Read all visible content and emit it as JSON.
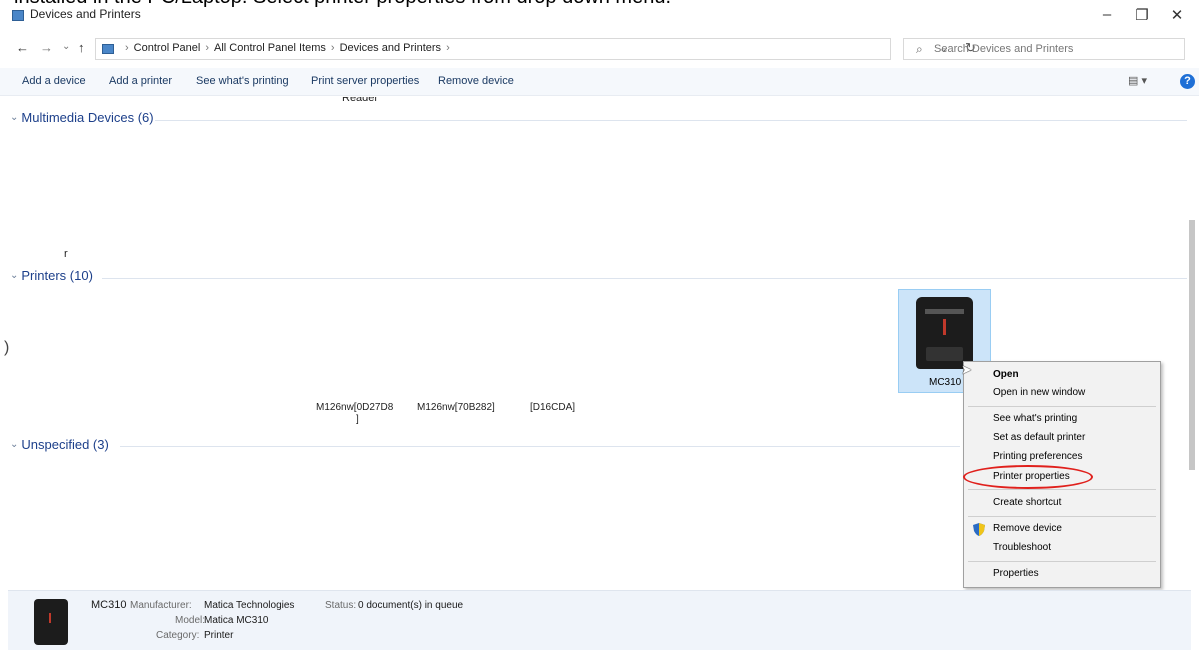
{
  "caption": "installed in the PC/Laptop. Select printer properties from drop down menu.",
  "window": {
    "title": "Devices and Printers",
    "controls": {
      "minimize": "–",
      "maximize": "❐",
      "close": "✕"
    }
  },
  "nav": {
    "back": "←",
    "forward": "→",
    "recent": "⌄",
    "up": "↑",
    "breadcrumb": [
      "Control Panel",
      "All Control Panel Items",
      "Devices and Printers"
    ],
    "breadcrumb_sep": "›",
    "dropdown": "⌄",
    "refresh": "↻",
    "search_placeholder": "Search Devices and Printers",
    "search_icon": "⌕"
  },
  "toolbar": {
    "add_device": "Add a device",
    "add_printer": "Add a printer",
    "see_printing": "See what's printing",
    "server_properties": "Print server properties",
    "remove_device": "Remove device",
    "view": "▤ ▾",
    "help": "?"
  },
  "groups": {
    "multimedia": "Multimedia Devices (6)",
    "printers": "Printers (10)",
    "unspecified": "Unspecified (3)",
    "chevron": "⌄"
  },
  "partial_text": {
    "reader": "Reader",
    "r": "r",
    "paren": ")"
  },
  "printers": {
    "label1_line1": "M126nw[0D27D8",
    "label1_line2": "]",
    "label2": "M126nw[70B282]",
    "label3": "[D16CDA]",
    "selected": "MC310"
  },
  "context_menu": {
    "open": "Open",
    "open_new_window": "Open in new window",
    "see_printing": "See what's printing",
    "set_default": "Set as default printer",
    "printing_preferences": "Printing preferences",
    "printer_properties": "Printer properties",
    "create_shortcut": "Create shortcut",
    "remove_device": "Remove device",
    "troubleshoot": "Troubleshoot",
    "properties": "Properties"
  },
  "details": {
    "name": "MC310",
    "manufacturer_key": "Manufacturer:",
    "manufacturer_val": "Matica Technologies",
    "model_key": "Model:",
    "model_val": "Matica MC310",
    "category_key": "Category:",
    "category_val": "Printer",
    "status_key": "Status:",
    "status_val": "0 document(s) in queue"
  },
  "colors": {
    "selection": "#cce4f9",
    "group_title": "#1c3f8a",
    "highlight_ring": "#e0201c",
    "help_blue": "#1e6fd6"
  }
}
